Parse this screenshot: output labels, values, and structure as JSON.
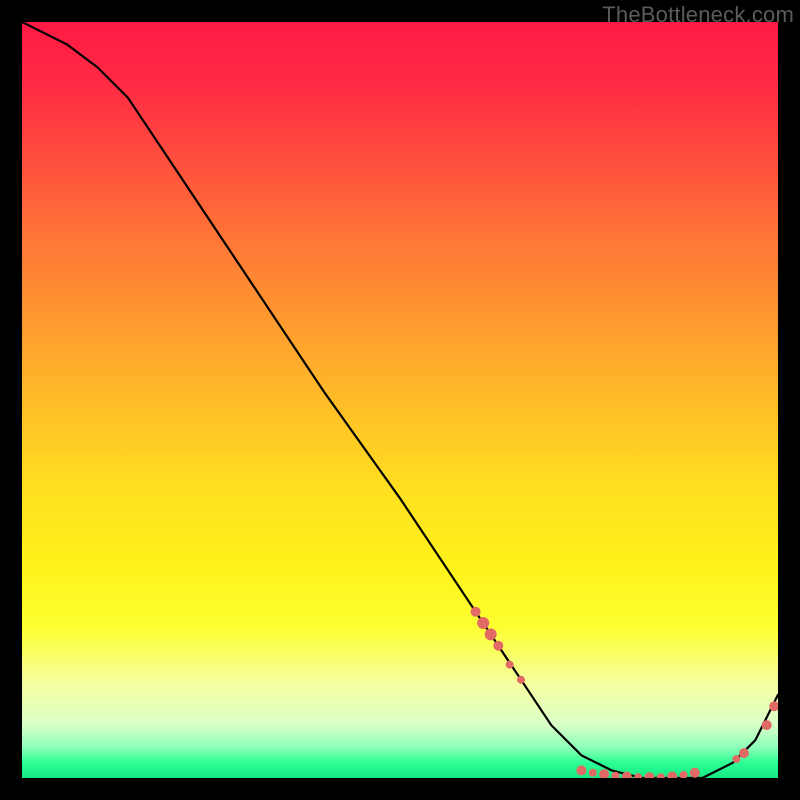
{
  "watermark": "TheBottleneck.com",
  "chart_data": {
    "type": "line",
    "title": "",
    "xlabel": "",
    "ylabel": "",
    "xlim": [
      0,
      100
    ],
    "ylim": [
      0,
      100
    ],
    "series": [
      {
        "name": "curve",
        "x": [
          0,
          6,
          10,
          14,
          20,
          30,
          40,
          50,
          60,
          66,
          70,
          74,
          78,
          82,
          86,
          90,
          94,
          97,
          100
        ],
        "y": [
          100,
          97,
          94,
          90,
          81,
          66,
          51,
          37,
          22,
          13,
          7,
          3,
          1,
          0,
          0,
          0,
          2,
          5,
          11
        ]
      }
    ],
    "markers": [
      {
        "x": 60.0,
        "y": 22.0,
        "r": 5
      },
      {
        "x": 61.0,
        "y": 20.5,
        "r": 6
      },
      {
        "x": 62.0,
        "y": 19.0,
        "r": 6
      },
      {
        "x": 63.0,
        "y": 17.5,
        "r": 5
      },
      {
        "x": 64.5,
        "y": 15.0,
        "r": 4
      },
      {
        "x": 66.0,
        "y": 13.0,
        "r": 4
      },
      {
        "x": 74.0,
        "y": 1.0,
        "r": 5
      },
      {
        "x": 75.5,
        "y": 0.7,
        "r": 4
      },
      {
        "x": 77.0,
        "y": 0.5,
        "r": 5
      },
      {
        "x": 78.5,
        "y": 0.3,
        "r": 4
      },
      {
        "x": 80.0,
        "y": 0.2,
        "r": 5
      },
      {
        "x": 81.5,
        "y": 0.1,
        "r": 4
      },
      {
        "x": 83.0,
        "y": 0.1,
        "r": 5
      },
      {
        "x": 84.5,
        "y": 0.1,
        "r": 4
      },
      {
        "x": 86.0,
        "y": 0.2,
        "r": 5
      },
      {
        "x": 87.5,
        "y": 0.4,
        "r": 4
      },
      {
        "x": 89.0,
        "y": 0.7,
        "r": 5
      },
      {
        "x": 94.5,
        "y": 2.5,
        "r": 4
      },
      {
        "x": 95.5,
        "y": 3.3,
        "r": 5
      },
      {
        "x": 98.5,
        "y": 7.0,
        "r": 5
      },
      {
        "x": 99.5,
        "y": 9.5,
        "r": 5
      }
    ],
    "colors": {
      "curve": "#000000",
      "marker": "#e16a64",
      "gradient_top": "#ff1a44",
      "gradient_mid": "#ffe020",
      "gradient_bottom": "#17e884"
    }
  }
}
